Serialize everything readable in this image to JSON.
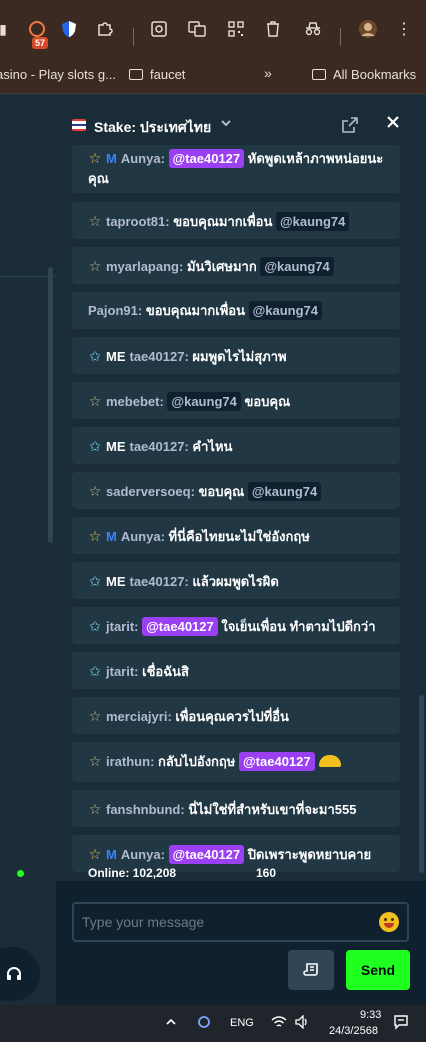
{
  "browser": {
    "extension_badge": "57",
    "bookmarks": [
      {
        "label": "asino - Play slots g..."
      },
      {
        "label": "faucet"
      },
      {
        "label": "All Bookmarks"
      }
    ],
    "overflow_label": "»"
  },
  "chat": {
    "room_title": "Stake: ประเทศไทย",
    "messages": [
      {
        "star": "gold",
        "badge": "M",
        "user": "Aunya",
        "mention": "@tae40127",
        "mention_style": "purple",
        "text": "หัดพูดเหล้าภาพหน่อยนะคุณ"
      },
      {
        "star": "gray",
        "badge": "",
        "user": "taproot81",
        "text": "ขอบคุณมากเพื่อน",
        "mention": "@kaung74",
        "mention_style": "dark"
      },
      {
        "star": "gray",
        "badge": "",
        "user": "myarlapang",
        "text": "มันวิเศษมาก",
        "mention": "@kaung74",
        "mention_style": "dark"
      },
      {
        "star": "none",
        "badge": "",
        "user": "Pajon91",
        "text": "ขอบคุณมากเพื่อน",
        "mention": "@kaung74",
        "mention_style": "dark"
      },
      {
        "star": "cyan",
        "badge": "ME",
        "user": "tae40127",
        "text": "ผมพูดไรไม่สุภาพ"
      },
      {
        "star": "gray",
        "badge": "",
        "user": "mebebet",
        "mention": "@kaung74",
        "mention_style": "dark",
        "text": "ขอบคุณ"
      },
      {
        "star": "cyan",
        "badge": "ME",
        "user": "tae40127",
        "text": "คำไหน"
      },
      {
        "star": "gray",
        "badge": "",
        "user": "saderversoeq",
        "text": "ขอบคุณ",
        "mention": "@kaung74",
        "mention_style": "dark"
      },
      {
        "star": "gold",
        "badge": "M",
        "user": "Aunya",
        "text": "ที่นี่คือไทยนะไม่ใช่อังกฤษ"
      },
      {
        "star": "cyan",
        "badge": "ME",
        "user": "tae40127",
        "text": "แล้วผมพูดไรผิด"
      },
      {
        "star": "cyan",
        "badge": "",
        "user": "jtarit",
        "mention": "@tae40127",
        "mention_style": "purple",
        "text": "ใจเย็นเพื่อน ทำตามไปดีกว่า"
      },
      {
        "star": "cyan",
        "badge": "",
        "user": "jtarit",
        "text": "เชื่อฉันสิ"
      },
      {
        "star": "gray",
        "badge": "",
        "user": "merciajyri",
        "text": "เพื่อนคุณควรไปที่อื่น"
      },
      {
        "star": "gray",
        "badge": "",
        "user": "irathun",
        "text": "กลับไปอังกฤษ",
        "mention": "@tae40127",
        "mention_style": "purple"
      },
      {
        "star": "gray",
        "badge": "",
        "user": "fanshnbund",
        "text": "นี่ไม่ใช่ที่สำหรับเขาที่จะมา555"
      },
      {
        "star": "gold",
        "badge": "M",
        "user": "Aunya",
        "mention": "@tae40127",
        "mention_style": "purple",
        "text": "ปิดเพราะพูดหยาบคาย"
      }
    ],
    "input": {
      "placeholder": "Type your message",
      "value": ""
    },
    "online_label": "Online: 102,208",
    "char_limit": "160",
    "send_label": "Send"
  },
  "taskbar": {
    "language": "ENG",
    "time": "9:33",
    "date": "24/3/2568"
  },
  "colors": {
    "panel_bg": "#1a2c38",
    "message_bg": "#213743",
    "input_bg": "#0f212e",
    "send_green": "#1fff20",
    "mention_purple": "#9a3ff2",
    "mod_blue": "#3b82f6"
  }
}
